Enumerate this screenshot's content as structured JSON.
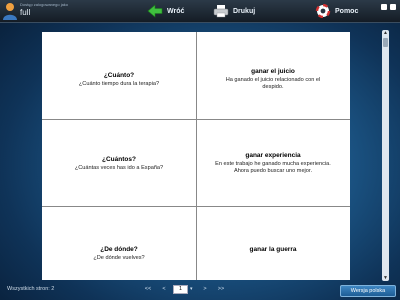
{
  "user": {
    "small_text": "Dostęp zalogowanego jako",
    "name": "full"
  },
  "toolbar": {
    "back_label": "Wróć",
    "print_label": "Drukuj",
    "help_label": "Pomoc"
  },
  "cards": [
    {
      "heading": "¿Cuánto?",
      "text": "¿Cuánto tiempo dura la terapia?"
    },
    {
      "heading": "ganar el juicio",
      "text": "Ha ganado el juicio relacionado con el despido."
    },
    {
      "heading": "¿Cuántos?",
      "text": "¿Cuántas veces has ido a España?"
    },
    {
      "heading": "ganar experiencia",
      "text": "En este trabajo he ganado mucha experiencia. Ahora puedo buscar uno mejor."
    },
    {
      "heading": "¿De dónde?",
      "text": "¿De dónde vuelves?"
    },
    {
      "heading": "ganar la guerra",
      "text": ""
    }
  ],
  "footer": {
    "pages_label": "Wszystkich stron: 2",
    "first": "<<",
    "prev": "<",
    "current_page": "1",
    "next": ">",
    "last": ">>",
    "language_button": "Wersja polska"
  }
}
